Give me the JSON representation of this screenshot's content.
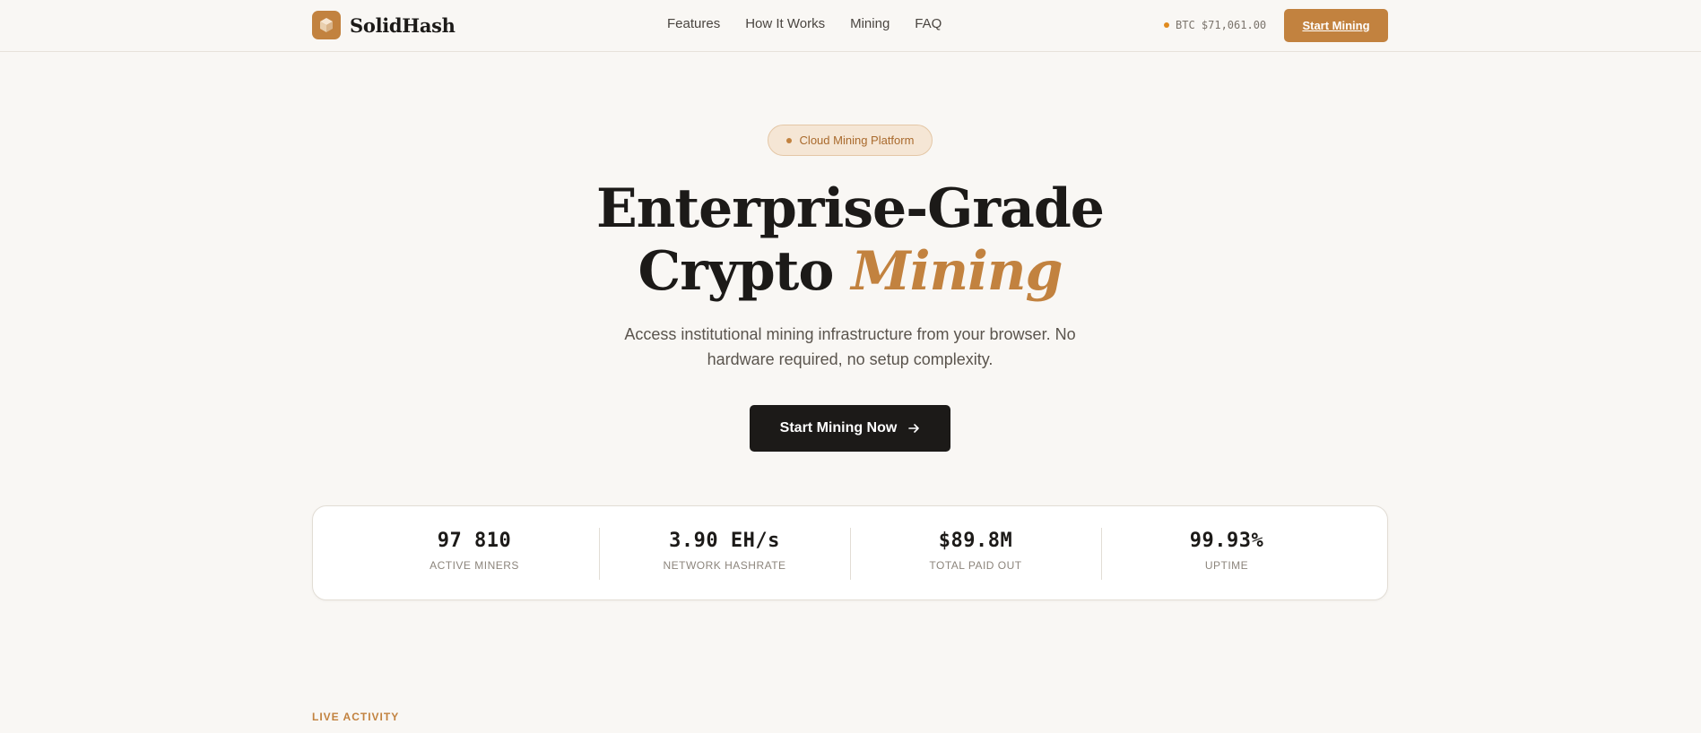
{
  "brand": {
    "name": "SolidHash",
    "logo_icon": "cube-icon",
    "accent": "#c2823f"
  },
  "nav": {
    "links": [
      "Features",
      "How It Works",
      "Mining",
      "FAQ"
    ],
    "btc_price": "BTC $71,061.00",
    "cta_label": "Start Mining"
  },
  "hero": {
    "badge": "Cloud Mining Platform",
    "title_line1": "Enterprise-Grade",
    "title_line2_plain": "Crypto",
    "title_line2_accent": "Mining",
    "subtitle": "Access institutional mining infrastructure from your browser. No hardware required, no setup complexity.",
    "cta_label": "Start Mining Now",
    "cta_icon": "arrow-right-icon"
  },
  "stats": [
    {
      "value": "97 810",
      "label": "Active Miners"
    },
    {
      "value": "3.90 EH/s",
      "label": "Network Hashrate"
    },
    {
      "value": "$89.8M",
      "label": "Total Paid Out"
    },
    {
      "value": "99.93%",
      "label": "Uptime"
    }
  ],
  "section": {
    "label": "LIVE ACTIVITY"
  },
  "colors": {
    "background": "#f9f7f4",
    "dark": "#1c1a18",
    "accent": "#c2823f",
    "btc_dot": "#e08a1e"
  }
}
